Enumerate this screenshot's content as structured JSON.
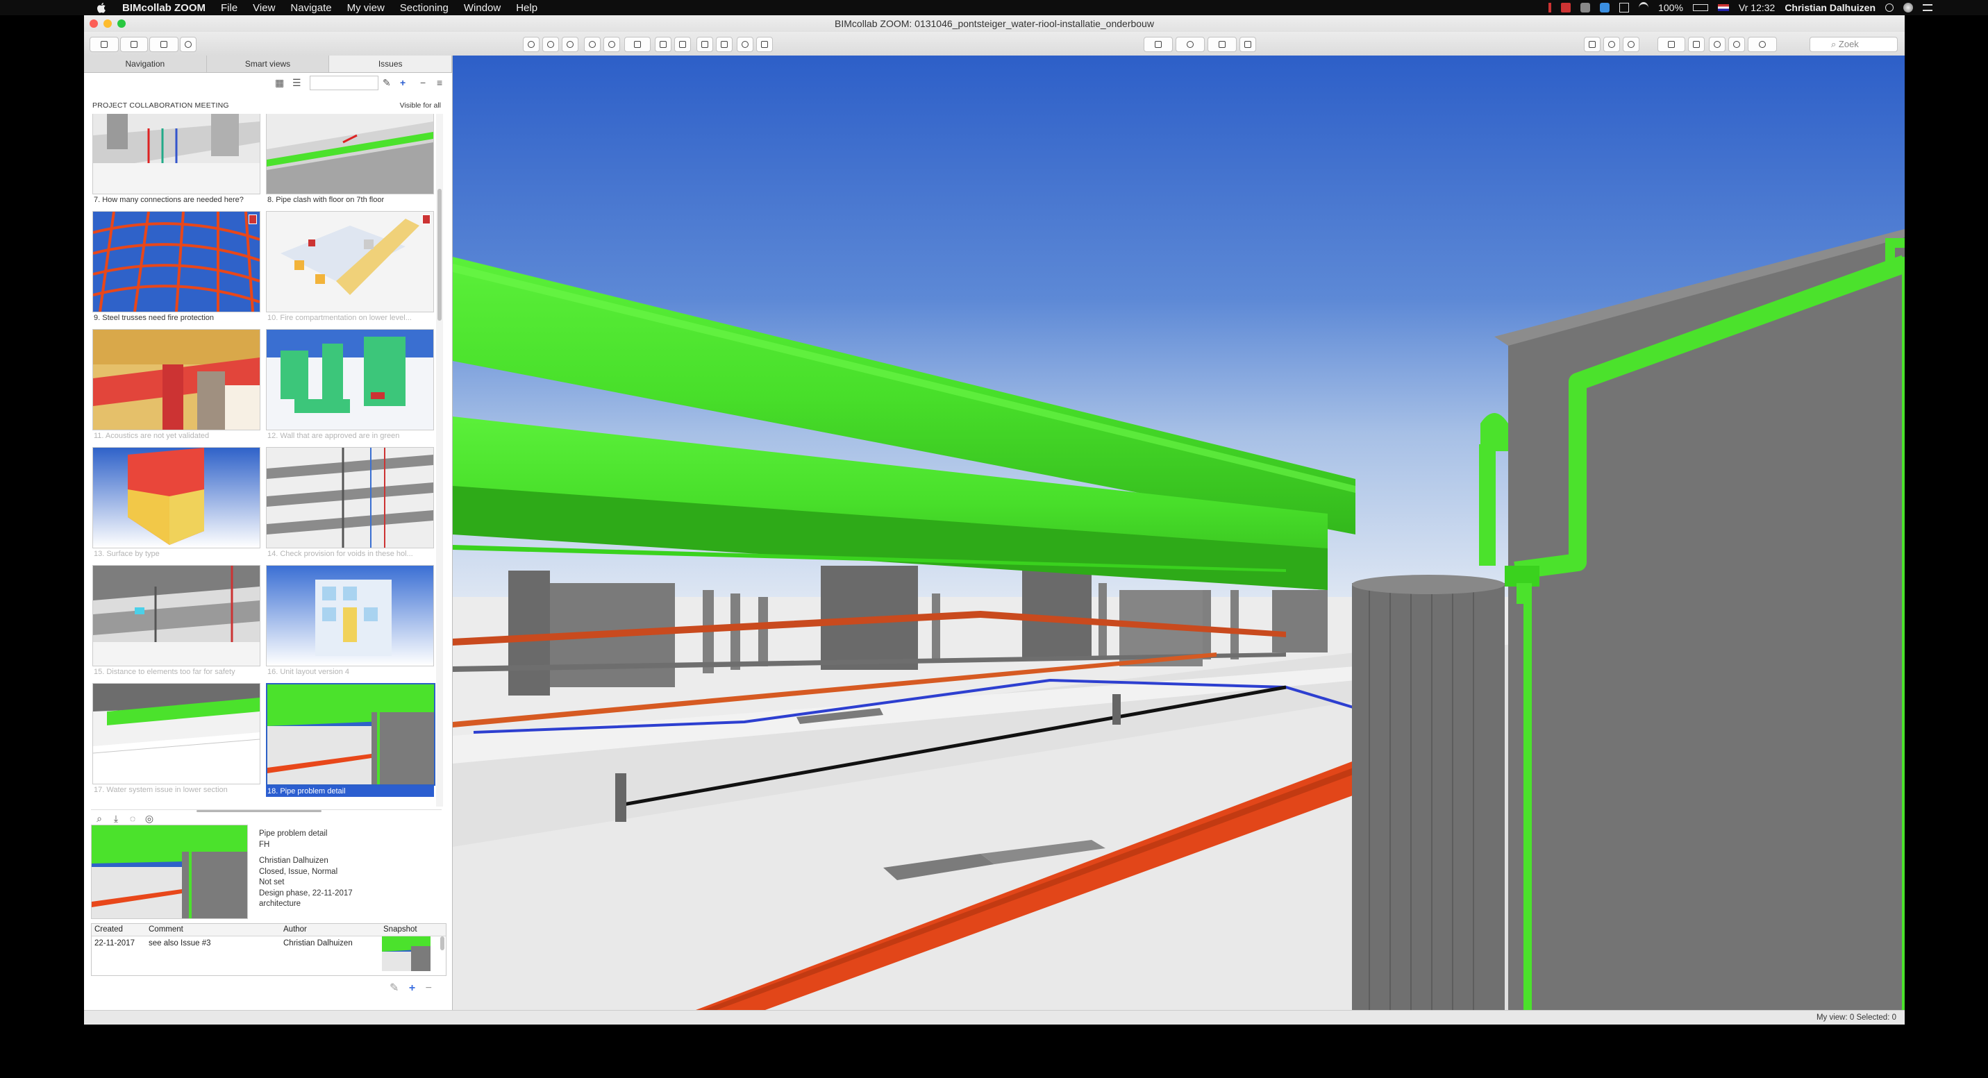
{
  "menubar": {
    "app_name": "BIMcollab ZOOM",
    "items": [
      "File",
      "View",
      "Navigate",
      "My view",
      "Sectioning",
      "Window",
      "Help"
    ],
    "battery": "100%",
    "clock": "Vr 12:32",
    "user": "Christian Dalhuizen"
  },
  "window": {
    "title": "BIMcollab ZOOM: 0131046_pontsteiger_water-riool-installatie_onderbouw"
  },
  "toolbar": {
    "search_placeholder": "Zoek"
  },
  "panel": {
    "tabs": [
      {
        "label": "Navigation",
        "active": false
      },
      {
        "label": "Smart views",
        "active": false
      },
      {
        "label": "Issues",
        "active": true
      }
    ],
    "section_title": "PROJECT COLLABORATION MEETING",
    "visibility": "Visible for all",
    "issues": [
      {
        "caption": "7. How many connections are needed here?",
        "dim": false
      },
      {
        "caption": "8. Pipe clash with floor on 7th floor",
        "dim": false
      },
      {
        "caption": "9. Steel trusses need fire protection",
        "dim": false
      },
      {
        "caption": "10. Fire compartmentation on lower level...",
        "dim": true
      },
      {
        "caption": "11. Acoustics are not yet validated",
        "dim": true
      },
      {
        "caption": "12. Wall that are approved are in green",
        "dim": true
      },
      {
        "caption": "13. Surface by type",
        "dim": true
      },
      {
        "caption": "14. Check provision for voids in these hol...",
        "dim": true
      },
      {
        "caption": "15. Distance to elements too far for safety",
        "dim": true
      },
      {
        "caption": "16. Unit layout version 4",
        "dim": true
      },
      {
        "caption": "17. Water system issue in lower section",
        "dim": true
      },
      {
        "caption": "18. Pipe problem detail",
        "dim": false,
        "selected": true
      }
    ],
    "detail": {
      "title": "Pipe problem detail",
      "assignee": "FH",
      "author": "Christian Dalhuizen",
      "status": "Closed, Issue, Normal",
      "due": "Not set",
      "milestone": "Design phase, 22-11-2017",
      "label": "architecture"
    },
    "comments": {
      "headers": [
        "Created",
        "Comment",
        "Author",
        "Snapshot"
      ],
      "rows": [
        {
          "created": "22-11-2017",
          "comment": "see also Issue #3",
          "author": "Christian Dalhuizen"
        }
      ]
    }
  },
  "statusbar": {
    "text": "My view: 0    Selected: 0"
  },
  "colors": {
    "pipe_green": "#4be22c",
    "pipe_red": "#e8471a",
    "sky_top": "#2f62c9",
    "selection_blue": "#2b5ed0"
  }
}
